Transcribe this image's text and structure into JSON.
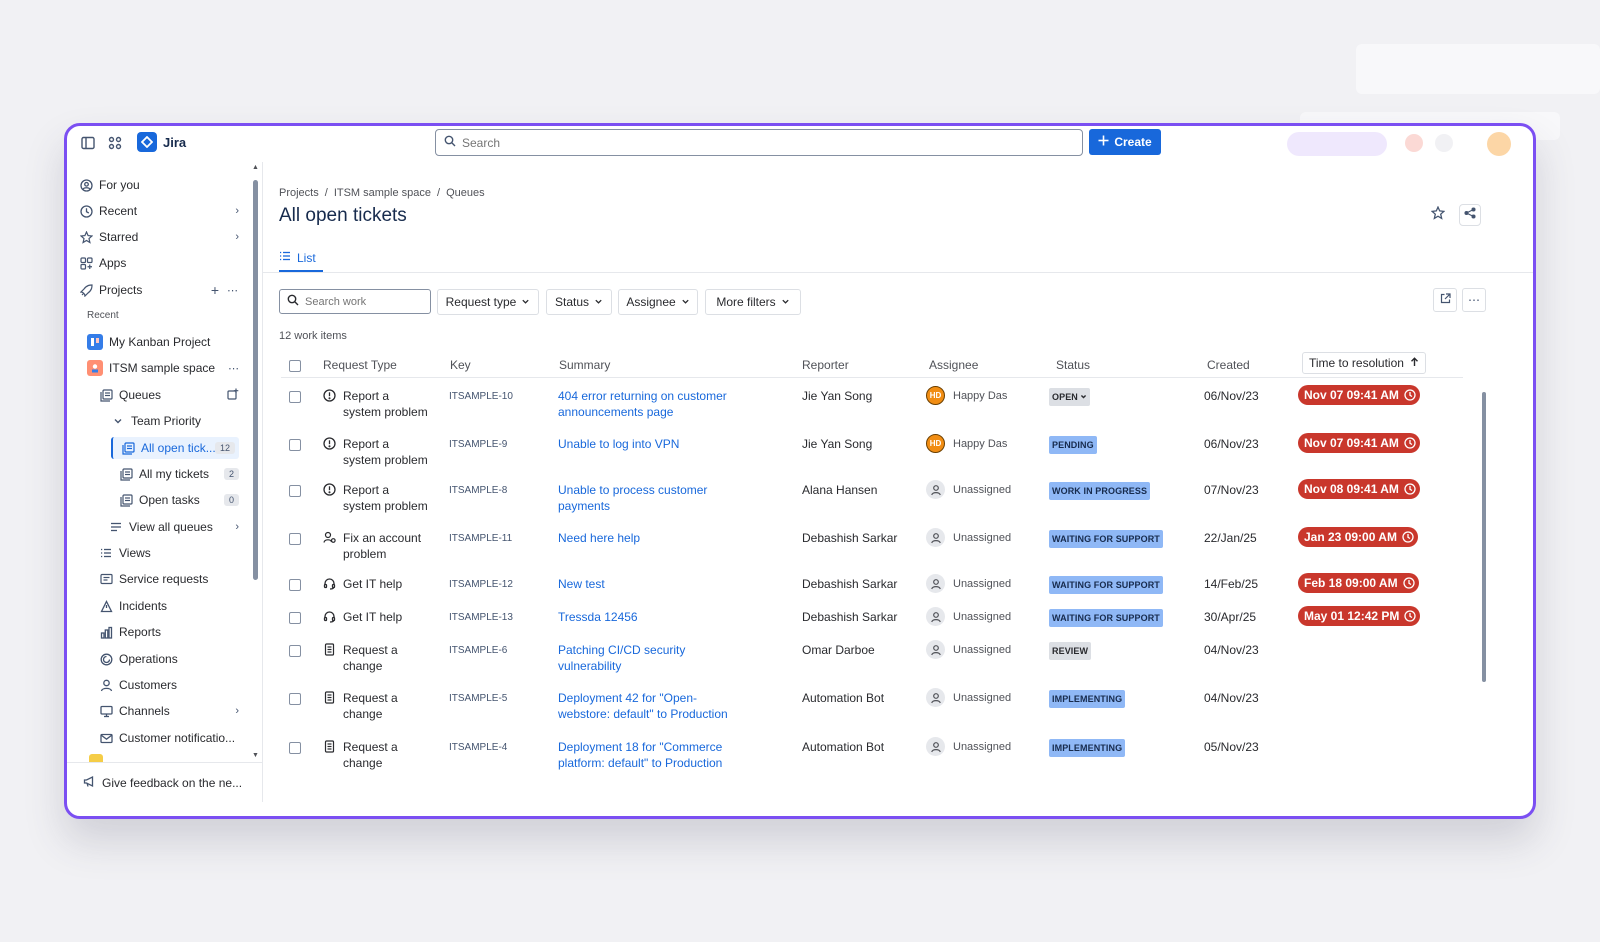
{
  "app": {
    "name": "Jira"
  },
  "search": {
    "placeholder": "Search"
  },
  "create": {
    "label": "Create"
  },
  "sidebar": {
    "items": [
      {
        "label": "For you"
      },
      {
        "label": "Recent"
      },
      {
        "label": "Starred"
      },
      {
        "label": "Apps"
      },
      {
        "label": "Projects"
      }
    ],
    "recent_label": "Recent",
    "projects": [
      {
        "label": "My Kanban Project"
      },
      {
        "label": "ITSM sample space"
      }
    ],
    "space_items": [
      {
        "label": "Queues"
      },
      {
        "label": "Team Priority"
      },
      {
        "label": "All open tick...",
        "badge": "12"
      },
      {
        "label": "All my tickets",
        "badge": "2"
      },
      {
        "label": "Open tasks",
        "badge": "0"
      },
      {
        "label": "View all queues"
      },
      {
        "label": "Views"
      },
      {
        "label": "Service requests"
      },
      {
        "label": "Incidents"
      },
      {
        "label": "Reports"
      },
      {
        "label": "Operations"
      },
      {
        "label": "Customers"
      },
      {
        "label": "Channels"
      },
      {
        "label": "Customer notificatio..."
      }
    ],
    "feedback": "Give feedback on the ne..."
  },
  "main": {
    "breadcrumb": [
      "Projects",
      "ITSM sample space",
      "Queues"
    ],
    "title": "All open tickets",
    "tab": "List",
    "search_placeholder": "Search work",
    "filters": [
      "Request type",
      "Status",
      "Assignee",
      "More filters"
    ],
    "count": "12 work items",
    "columns": [
      "Request Type",
      "Key",
      "Summary",
      "Reporter",
      "Assignee",
      "Status",
      "Created",
      "Time to resolution"
    ],
    "rows": [
      {
        "type": "Report a system problem",
        "type_lines": [
          "Report a",
          "system problem"
        ],
        "icon": "alert-icon",
        "key": "ITSAMPLE-10",
        "summary_lines": [
          "404 error returning on customer",
          "announcements page"
        ],
        "reporter": "Jie Yan Song",
        "assignee": "Happy Das",
        "avatar": "HD",
        "status": "OPEN",
        "created": "06/Nov/23",
        "ttr": "Nov 07 09:41 AM"
      },
      {
        "type": "Report a system problem",
        "type_lines": [
          "Report a",
          "system problem"
        ],
        "icon": "alert-icon",
        "key": "ITSAMPLE-9",
        "summary_lines": [
          "Unable to log into VPN"
        ],
        "reporter": "Jie Yan Song",
        "assignee": "Happy Das",
        "avatar": "HD",
        "status": "PENDING",
        "created": "06/Nov/23",
        "ttr": "Nov 07 09:41 AM"
      },
      {
        "type": "Report a system problem",
        "type_lines": [
          "Report a",
          "system problem"
        ],
        "icon": "alert-icon",
        "key": "ITSAMPLE-8",
        "summary_lines": [
          "Unable to process customer",
          "payments"
        ],
        "reporter": "Alana Hansen",
        "assignee": "Unassigned",
        "avatar": "",
        "status": "WORK IN PROGRESS",
        "created": "07/Nov/23",
        "ttr": "Nov 08 09:41 AM"
      },
      {
        "type": "Fix an account problem",
        "type_lines": [
          "Fix an account",
          "problem"
        ],
        "icon": "account-icon",
        "key": "ITSAMPLE-11",
        "summary_lines": [
          "Need here help"
        ],
        "reporter": "Debashish Sarkar",
        "assignee": "Unassigned",
        "avatar": "",
        "status": "WAITING FOR SUPPORT",
        "created": "22/Jan/25",
        "ttr": "Jan 23 09:00 AM"
      },
      {
        "type": "Get IT help",
        "type_lines": [
          "Get IT help"
        ],
        "icon": "headset-icon",
        "key": "ITSAMPLE-12",
        "summary_lines": [
          "New test"
        ],
        "reporter": "Debashish Sarkar",
        "assignee": "Unassigned",
        "avatar": "",
        "status": "WAITING FOR SUPPORT",
        "created": "14/Feb/25",
        "ttr": "Feb 18 09:00 AM"
      },
      {
        "type": "Get IT help",
        "type_lines": [
          "Get IT help"
        ],
        "icon": "headset-icon",
        "key": "ITSAMPLE-13",
        "summary_lines": [
          "Tressda 12456"
        ],
        "reporter": "Debashish Sarkar",
        "assignee": "Unassigned",
        "avatar": "",
        "status": "WAITING FOR SUPPORT",
        "created": "30/Apr/25",
        "ttr": "May 01 12:42 PM"
      },
      {
        "type": "Request a change",
        "type_lines": [
          "Request a",
          "change"
        ],
        "icon": "change-icon",
        "key": "ITSAMPLE-6",
        "summary_lines": [
          "Patching CI/CD security",
          "vulnerability"
        ],
        "reporter": "Omar Darboe",
        "assignee": "Unassigned",
        "avatar": "",
        "status": "REVIEW",
        "created": "04/Nov/23",
        "ttr": ""
      },
      {
        "type": "Request a change",
        "type_lines": [
          "Request a",
          "change"
        ],
        "icon": "change-icon",
        "key": "ITSAMPLE-5",
        "summary_lines": [
          "Deployment 42 for \"Open-",
          "webstore: default\" to Production"
        ],
        "reporter": "Automation Bot",
        "assignee": "Unassigned",
        "avatar": "",
        "status": "IMPLEMENTING",
        "created": "04/Nov/23",
        "ttr": ""
      },
      {
        "type": "Request a change",
        "type_lines": [
          "Request a",
          "change"
        ],
        "icon": "change-icon",
        "key": "ITSAMPLE-4",
        "summary_lines": [
          "Deployment 18 for \"Commerce",
          "platform: default\" to Production"
        ],
        "reporter": "Automation Bot",
        "assignee": "Unassigned",
        "avatar": "",
        "status": "IMPLEMENTING",
        "created": "05/Nov/23",
        "ttr": ""
      }
    ]
  },
  "colors": {
    "accent": "#1868db",
    "frame": "#7b4ff2",
    "breach": "#c9372c",
    "status_blue": "#8fb8f6",
    "status_grey": "#dcdfe4"
  }
}
